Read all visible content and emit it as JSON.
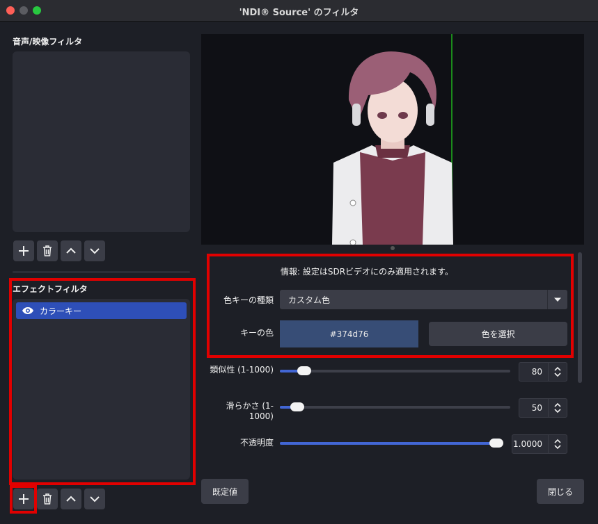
{
  "window": {
    "title": "'NDI® Source' のフィルタ"
  },
  "left": {
    "audio_video_label": "音声/映像フィルタ",
    "effect_label": "エフェクトフィルタ",
    "effect_items": [
      {
        "label": "カラーキー",
        "visible": true
      }
    ]
  },
  "properties": {
    "info": "情報: 設定はSDRビデオにのみ適用されます。",
    "key_type": {
      "label": "色キーの種類",
      "value": "カスタム色"
    },
    "key_color": {
      "label": "キーの色",
      "hex": "#374d76",
      "button": "色を選択"
    },
    "similarity": {
      "label": "類似性 (1-1000)",
      "value": "80",
      "level": 0.08
    },
    "smoothness": {
      "label": "滑らかさ (1-1000)",
      "value": "50",
      "level": 0.05
    },
    "opacity": {
      "label": "不透明度",
      "value": "1.0000",
      "level": 1.0
    }
  },
  "buttons": {
    "defaults": "既定値",
    "close": "閉じる"
  },
  "colors": {
    "accent": "#2e4fb8",
    "highlight": "#e10000",
    "key_color": "#374d76"
  }
}
